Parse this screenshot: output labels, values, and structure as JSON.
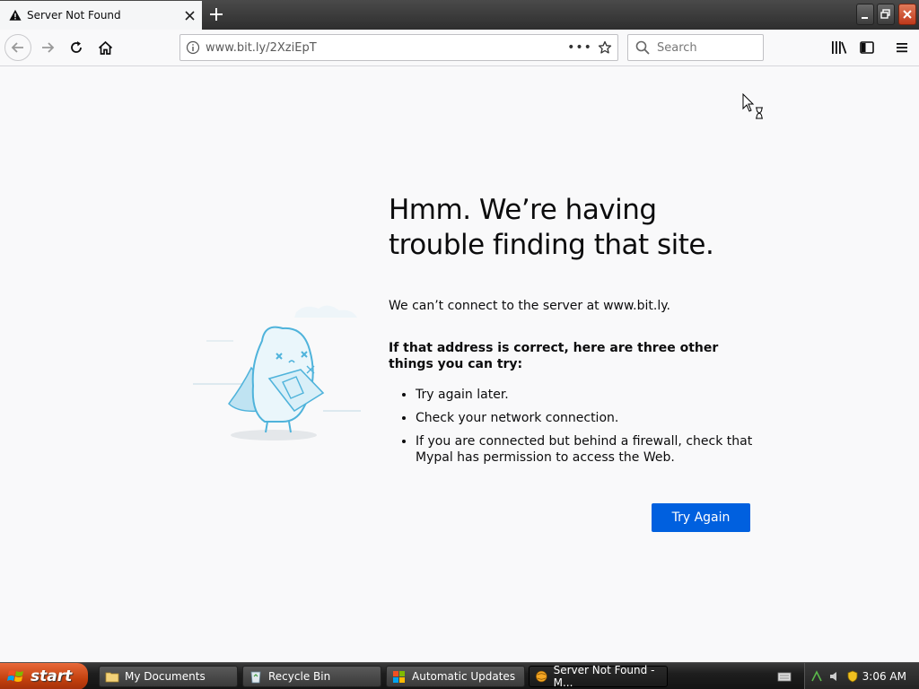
{
  "tab": {
    "title": "Server Not Found"
  },
  "navbar": {
    "url": "www.bit.ly/2XziEpT",
    "search_placeholder": "Search"
  },
  "error_page": {
    "heading": "Hmm. We’re having trouble finding that site.",
    "description": "We can’t connect to the server at www.bit.ly.",
    "suggestions_title": "If that address is correct, here are three other things you can try:",
    "suggestions": [
      "Try again later.",
      "Check your network connection.",
      "If you are connected but behind a firewall, check that Mypal has permission to access the Web."
    ],
    "try_again_label": "Try Again"
  },
  "taskbar": {
    "start_label": "start",
    "tasks": [
      {
        "label": "My Documents"
      },
      {
        "label": "Recycle Bin"
      },
      {
        "label": "Automatic Updates"
      },
      {
        "label": "Server Not Found - M..."
      }
    ],
    "clock": "3:06 AM"
  },
  "colors": {
    "accent": "#0060df",
    "page_bg": "#f9f9fa",
    "start_button": "#c3400e"
  }
}
